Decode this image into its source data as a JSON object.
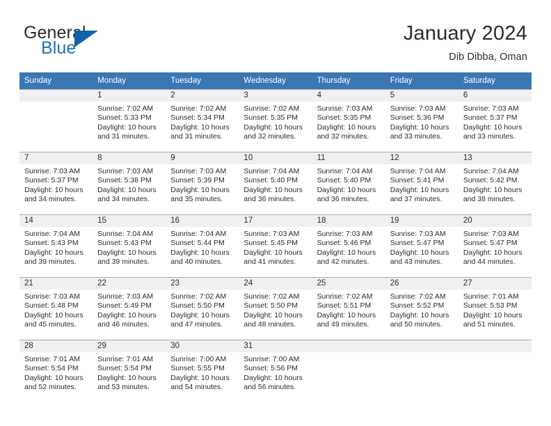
{
  "brand": {
    "name_part1": "General",
    "name_part2": "Blue",
    "accent_color": "#1162a8",
    "triangle_icon": "brand-triangle-icon"
  },
  "header": {
    "title": "January 2024",
    "subtitle": "Dib Dibba, Oman"
  },
  "calendar": {
    "header_bg": "#3a77b5",
    "daynum_bg": "#f0f0f0",
    "weekdays": [
      "Sunday",
      "Monday",
      "Tuesday",
      "Wednesday",
      "Thursday",
      "Friday",
      "Saturday"
    ],
    "weeks": [
      [
        {
          "day": "",
          "lines": []
        },
        {
          "day": "1",
          "lines": [
            "Sunrise: 7:02 AM",
            "Sunset: 5:33 PM",
            "Daylight: 10 hours",
            "and 31 minutes."
          ]
        },
        {
          "day": "2",
          "lines": [
            "Sunrise: 7:02 AM",
            "Sunset: 5:34 PM",
            "Daylight: 10 hours",
            "and 31 minutes."
          ]
        },
        {
          "day": "3",
          "lines": [
            "Sunrise: 7:02 AM",
            "Sunset: 5:35 PM",
            "Daylight: 10 hours",
            "and 32 minutes."
          ]
        },
        {
          "day": "4",
          "lines": [
            "Sunrise: 7:03 AM",
            "Sunset: 5:35 PM",
            "Daylight: 10 hours",
            "and 32 minutes."
          ]
        },
        {
          "day": "5",
          "lines": [
            "Sunrise: 7:03 AM",
            "Sunset: 5:36 PM",
            "Daylight: 10 hours",
            "and 33 minutes."
          ]
        },
        {
          "day": "6",
          "lines": [
            "Sunrise: 7:03 AM",
            "Sunset: 5:37 PM",
            "Daylight: 10 hours",
            "and 33 minutes."
          ]
        }
      ],
      [
        {
          "day": "7",
          "lines": [
            "Sunrise: 7:03 AM",
            "Sunset: 5:37 PM",
            "Daylight: 10 hours",
            "and 34 minutes."
          ]
        },
        {
          "day": "8",
          "lines": [
            "Sunrise: 7:03 AM",
            "Sunset: 5:38 PM",
            "Daylight: 10 hours",
            "and 34 minutes."
          ]
        },
        {
          "day": "9",
          "lines": [
            "Sunrise: 7:03 AM",
            "Sunset: 5:39 PM",
            "Daylight: 10 hours",
            "and 35 minutes."
          ]
        },
        {
          "day": "10",
          "lines": [
            "Sunrise: 7:04 AM",
            "Sunset: 5:40 PM",
            "Daylight: 10 hours",
            "and 36 minutes."
          ]
        },
        {
          "day": "11",
          "lines": [
            "Sunrise: 7:04 AM",
            "Sunset: 5:40 PM",
            "Daylight: 10 hours",
            "and 36 minutes."
          ]
        },
        {
          "day": "12",
          "lines": [
            "Sunrise: 7:04 AM",
            "Sunset: 5:41 PM",
            "Daylight: 10 hours",
            "and 37 minutes."
          ]
        },
        {
          "day": "13",
          "lines": [
            "Sunrise: 7:04 AM",
            "Sunset: 5:42 PM",
            "Daylight: 10 hours",
            "and 38 minutes."
          ]
        }
      ],
      [
        {
          "day": "14",
          "lines": [
            "Sunrise: 7:04 AM",
            "Sunset: 5:43 PM",
            "Daylight: 10 hours",
            "and 39 minutes."
          ]
        },
        {
          "day": "15",
          "lines": [
            "Sunrise: 7:04 AM",
            "Sunset: 5:43 PM",
            "Daylight: 10 hours",
            "and 39 minutes."
          ]
        },
        {
          "day": "16",
          "lines": [
            "Sunrise: 7:04 AM",
            "Sunset: 5:44 PM",
            "Daylight: 10 hours",
            "and 40 minutes."
          ]
        },
        {
          "day": "17",
          "lines": [
            "Sunrise: 7:03 AM",
            "Sunset: 5:45 PM",
            "Daylight: 10 hours",
            "and 41 minutes."
          ]
        },
        {
          "day": "18",
          "lines": [
            "Sunrise: 7:03 AM",
            "Sunset: 5:46 PM",
            "Daylight: 10 hours",
            "and 42 minutes."
          ]
        },
        {
          "day": "19",
          "lines": [
            "Sunrise: 7:03 AM",
            "Sunset: 5:47 PM",
            "Daylight: 10 hours",
            "and 43 minutes."
          ]
        },
        {
          "day": "20",
          "lines": [
            "Sunrise: 7:03 AM",
            "Sunset: 5:47 PM",
            "Daylight: 10 hours",
            "and 44 minutes."
          ]
        }
      ],
      [
        {
          "day": "21",
          "lines": [
            "Sunrise: 7:03 AM",
            "Sunset: 5:48 PM",
            "Daylight: 10 hours",
            "and 45 minutes."
          ]
        },
        {
          "day": "22",
          "lines": [
            "Sunrise: 7:03 AM",
            "Sunset: 5:49 PM",
            "Daylight: 10 hours",
            "and 46 minutes."
          ]
        },
        {
          "day": "23",
          "lines": [
            "Sunrise: 7:02 AM",
            "Sunset: 5:50 PM",
            "Daylight: 10 hours",
            "and 47 minutes."
          ]
        },
        {
          "day": "24",
          "lines": [
            "Sunrise: 7:02 AM",
            "Sunset: 5:50 PM",
            "Daylight: 10 hours",
            "and 48 minutes."
          ]
        },
        {
          "day": "25",
          "lines": [
            "Sunrise: 7:02 AM",
            "Sunset: 5:51 PM",
            "Daylight: 10 hours",
            "and 49 minutes."
          ]
        },
        {
          "day": "26",
          "lines": [
            "Sunrise: 7:02 AM",
            "Sunset: 5:52 PM",
            "Daylight: 10 hours",
            "and 50 minutes."
          ]
        },
        {
          "day": "27",
          "lines": [
            "Sunrise: 7:01 AM",
            "Sunset: 5:53 PM",
            "Daylight: 10 hours",
            "and 51 minutes."
          ]
        }
      ],
      [
        {
          "day": "28",
          "lines": [
            "Sunrise: 7:01 AM",
            "Sunset: 5:54 PM",
            "Daylight: 10 hours",
            "and 52 minutes."
          ]
        },
        {
          "day": "29",
          "lines": [
            "Sunrise: 7:01 AM",
            "Sunset: 5:54 PM",
            "Daylight: 10 hours",
            "and 53 minutes."
          ]
        },
        {
          "day": "30",
          "lines": [
            "Sunrise: 7:00 AM",
            "Sunset: 5:55 PM",
            "Daylight: 10 hours",
            "and 54 minutes."
          ]
        },
        {
          "day": "31",
          "lines": [
            "Sunrise: 7:00 AM",
            "Sunset: 5:56 PM",
            "Daylight: 10 hours",
            "and 56 minutes."
          ]
        },
        {
          "day": "",
          "lines": []
        },
        {
          "day": "",
          "lines": []
        },
        {
          "day": "",
          "lines": []
        }
      ]
    ]
  }
}
